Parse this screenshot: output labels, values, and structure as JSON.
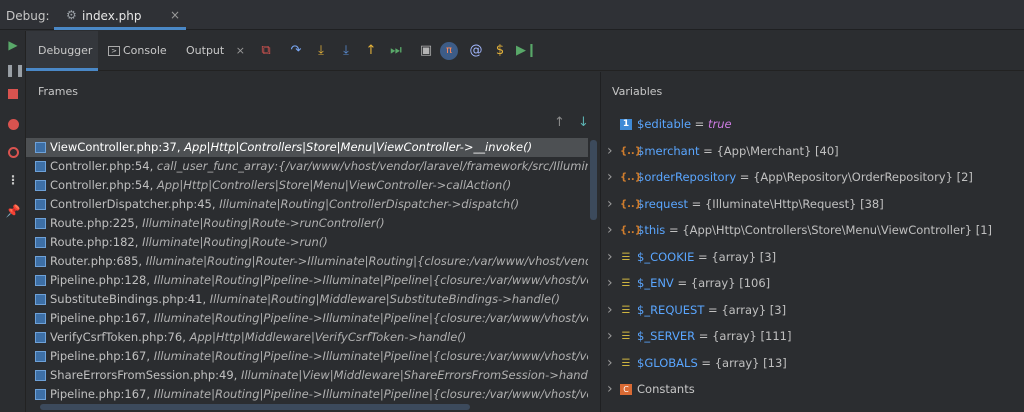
{
  "window": {
    "debug_label": "Debug:",
    "tab_title": "index.php",
    "tab_icon": "gear-icon",
    "tab_close": "×"
  },
  "tabs": {
    "debugger": "Debugger",
    "console": "Console",
    "output": "Output",
    "output_close": "×"
  },
  "frames": {
    "header": "Frames",
    "rows": [
      {
        "file": "ViewController.php:37,",
        "fn": "App|Http|Controllers|Store|Menu|ViewController->__invoke()"
      },
      {
        "file": "Controller.php:54,",
        "fn": "call_user_func_array:{/var/www/vhost/vendor/laravel/framework/src/Illuminate"
      },
      {
        "file": "Controller.php:54,",
        "fn": "App|Http|Controllers|Store|Menu|ViewController->callAction()"
      },
      {
        "file": "ControllerDispatcher.php:45,",
        "fn": "Illuminate|Routing|ControllerDispatcher->dispatch()"
      },
      {
        "file": "Route.php:225,",
        "fn": "Illuminate|Routing|Route->runController()"
      },
      {
        "file": "Route.php:182,",
        "fn": "Illuminate|Routing|Route->run()"
      },
      {
        "file": "Router.php:685,",
        "fn": "Illuminate|Routing|Router->Illuminate|Routing|{closure:/var/www/vhost/vendor/"
      },
      {
        "file": "Pipeline.php:128,",
        "fn": "Illuminate|Routing|Pipeline->Illuminate|Pipeline|{closure:/var/www/vhost/vendo"
      },
      {
        "file": "SubstituteBindings.php:41,",
        "fn": "Illuminate|Routing|Middleware|SubstituteBindings->handle()"
      },
      {
        "file": "Pipeline.php:167,",
        "fn": "Illuminate|Routing|Pipeline->Illuminate|Pipeline|{closure:/var/www/vhost/vendo"
      },
      {
        "file": "VerifyCsrfToken.php:76,",
        "fn": "App|Http|Middleware|VerifyCsrfToken->handle()"
      },
      {
        "file": "Pipeline.php:167,",
        "fn": "Illuminate|Routing|Pipeline->Illuminate|Pipeline|{closure:/var/www/vhost/vendo"
      },
      {
        "file": "ShareErrorsFromSession.php:49,",
        "fn": "Illuminate|View|Middleware|ShareErrorsFromSession->handle("
      },
      {
        "file": "Pipeline.php:167,",
        "fn": "Illuminate|Routing|Pipeline->Illuminate|Pipeline|{closure:/var/www/vhost/vendo"
      }
    ]
  },
  "variables": {
    "header": "Variables",
    "rows": [
      {
        "name": "$editable",
        "eq": " = ",
        "value": "true",
        "kind": "num",
        "icon_text": "1",
        "expandable": false,
        "bool": true
      },
      {
        "name": "$merchant",
        "eq": " = ",
        "value": "{App\\Merchant} [40]",
        "kind": "obj",
        "icon_text": "{..}",
        "expandable": true
      },
      {
        "name": "$orderRepository",
        "eq": " = ",
        "value": "{App\\Repository\\OrderRepository} [2]",
        "kind": "obj",
        "icon_text": "{..}",
        "expandable": true
      },
      {
        "name": "$request",
        "eq": " = ",
        "value": "{Illuminate\\Http\\Request} [38]",
        "kind": "obj",
        "icon_text": "{..}",
        "expandable": true
      },
      {
        "name": "$this",
        "eq": " = ",
        "value": "{App\\Http\\Controllers\\Store\\Menu\\ViewController} [1]",
        "kind": "obj",
        "icon_text": "{..}",
        "expandable": true
      },
      {
        "name": "$_COOKIE",
        "eq": " = ",
        "value": "{array} [3]",
        "kind": "arr",
        "icon_text": "☰",
        "expandable": true
      },
      {
        "name": "$_ENV",
        "eq": " = ",
        "value": "{array} [106]",
        "kind": "arr",
        "icon_text": "☰",
        "expandable": true
      },
      {
        "name": "$_REQUEST",
        "eq": " = ",
        "value": "{array} [3]",
        "kind": "arr",
        "icon_text": "☰",
        "expandable": true
      },
      {
        "name": "$_SERVER",
        "eq": " = ",
        "value": "{array} [111]",
        "kind": "arr",
        "icon_text": "☰",
        "expandable": true
      },
      {
        "name": "$GLOBALS",
        "eq": " = ",
        "value": "{array} [13]",
        "kind": "arr",
        "icon_text": "☰",
        "expandable": true
      },
      {
        "name": "Constants",
        "eq": "",
        "value": "",
        "kind": "const",
        "icon_text": "C",
        "expandable": true
      }
    ]
  },
  "colors": {
    "accent": "#4a88c7",
    "var_name": "#5aa6ff",
    "bool_value": "#cc7be0"
  }
}
